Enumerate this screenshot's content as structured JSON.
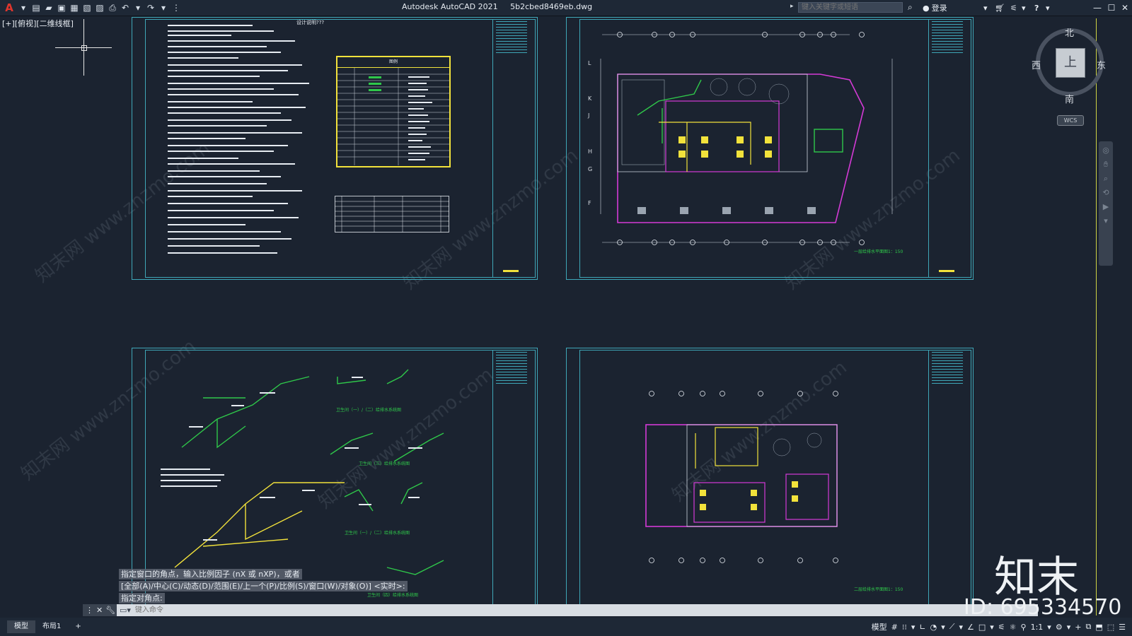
{
  "window": {
    "app_title": "Autodesk AutoCAD 2021",
    "file_name": "5b2cbed8469eb.dwg",
    "search_placeholder": "键入关键字或短语",
    "login_label": "登录",
    "help_icon": "question-icon"
  },
  "viewport": {
    "label": "[+][俯视][二维线框]"
  },
  "viewcube": {
    "top_face": "上",
    "north": "北",
    "south": "南",
    "east": "东",
    "west": "西",
    "wcs": "WCS"
  },
  "sheets": {
    "notes_title": "设计说明???",
    "legend_title": "图例",
    "plan1_caption": "一层给排水平面图1：150",
    "plan2_caption": "二层给排水平面图1：150",
    "sys_caption_1": "卫生间（一）/（二）给排水系统图",
    "sys_caption_2": "卫生间（三）给排水系统图",
    "sys_caption_3": "卫生间（一）/（二）给排水系统图",
    "sys_caption_4": "卫生间（四）给排水系统图"
  },
  "command": {
    "history": [
      "指定窗口的角点，输入比例因子 (nX 或 nXP)，或者",
      "[全部(A)/中心(C)/动态(D)/范围(E)/上一个(P)/比例(S)/窗口(W)/对象(O)] <实时>:",
      "指定对角点:"
    ],
    "input_placeholder": "键入命令"
  },
  "status": {
    "tabs": [
      "模型",
      "布局1"
    ],
    "add_tab": "+",
    "model_label": "模型",
    "scale": "1:1"
  },
  "branding": {
    "logo_text": "知末",
    "id_text": "ID: 695334570",
    "watermark": "知末网 www.znzmo.com"
  },
  "grid_labels": {
    "top_numbers": [
      "1",
      "2",
      "3",
      "4",
      "5",
      "6",
      "7",
      "8",
      "9"
    ],
    "side_letters": [
      "L",
      "K",
      "J",
      "H",
      "G",
      "F"
    ]
  }
}
